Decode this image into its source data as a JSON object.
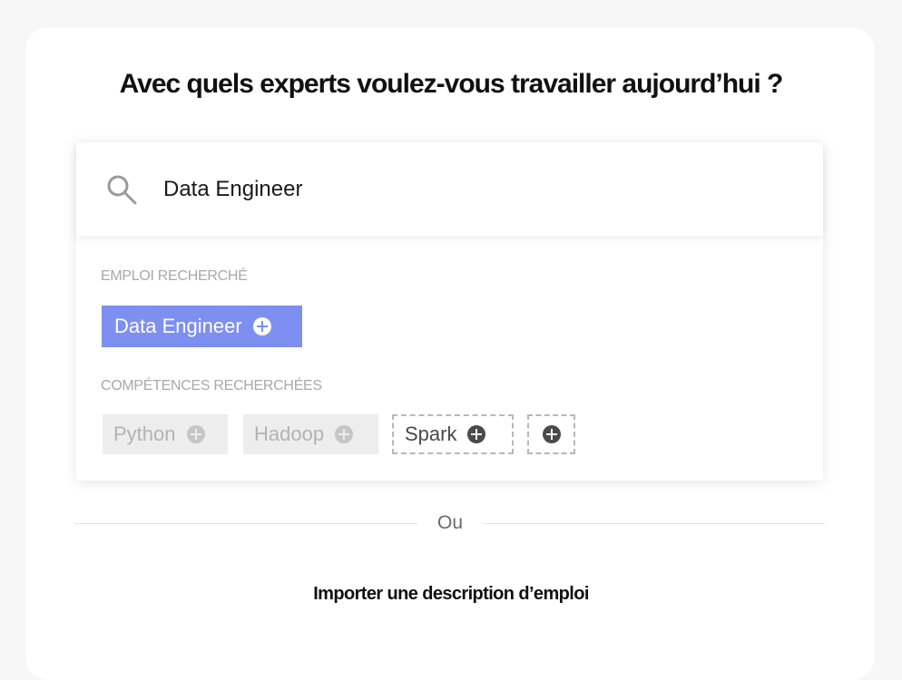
{
  "heading": "Avec quels experts voulez-vous travailler aujourd’hui ?",
  "search": {
    "value": "Data Engineer",
    "icon": "search-icon"
  },
  "job": {
    "section_label": "EMPLOI RECHERCHÉ",
    "chip_label": "Data Engineer",
    "chip_color": "#7d8ff0"
  },
  "skills": {
    "section_label": "COMPÉTENCES RECHERCHÉES",
    "items": [
      {
        "label": "Python",
        "state": "faded"
      },
      {
        "label": "Hadoop",
        "state": "faded"
      },
      {
        "label": "Spark",
        "state": "dashed"
      }
    ],
    "add_icon": "plus-circle-icon"
  },
  "separator_text": "Ou",
  "import_link": "Importer une description d’emploi"
}
